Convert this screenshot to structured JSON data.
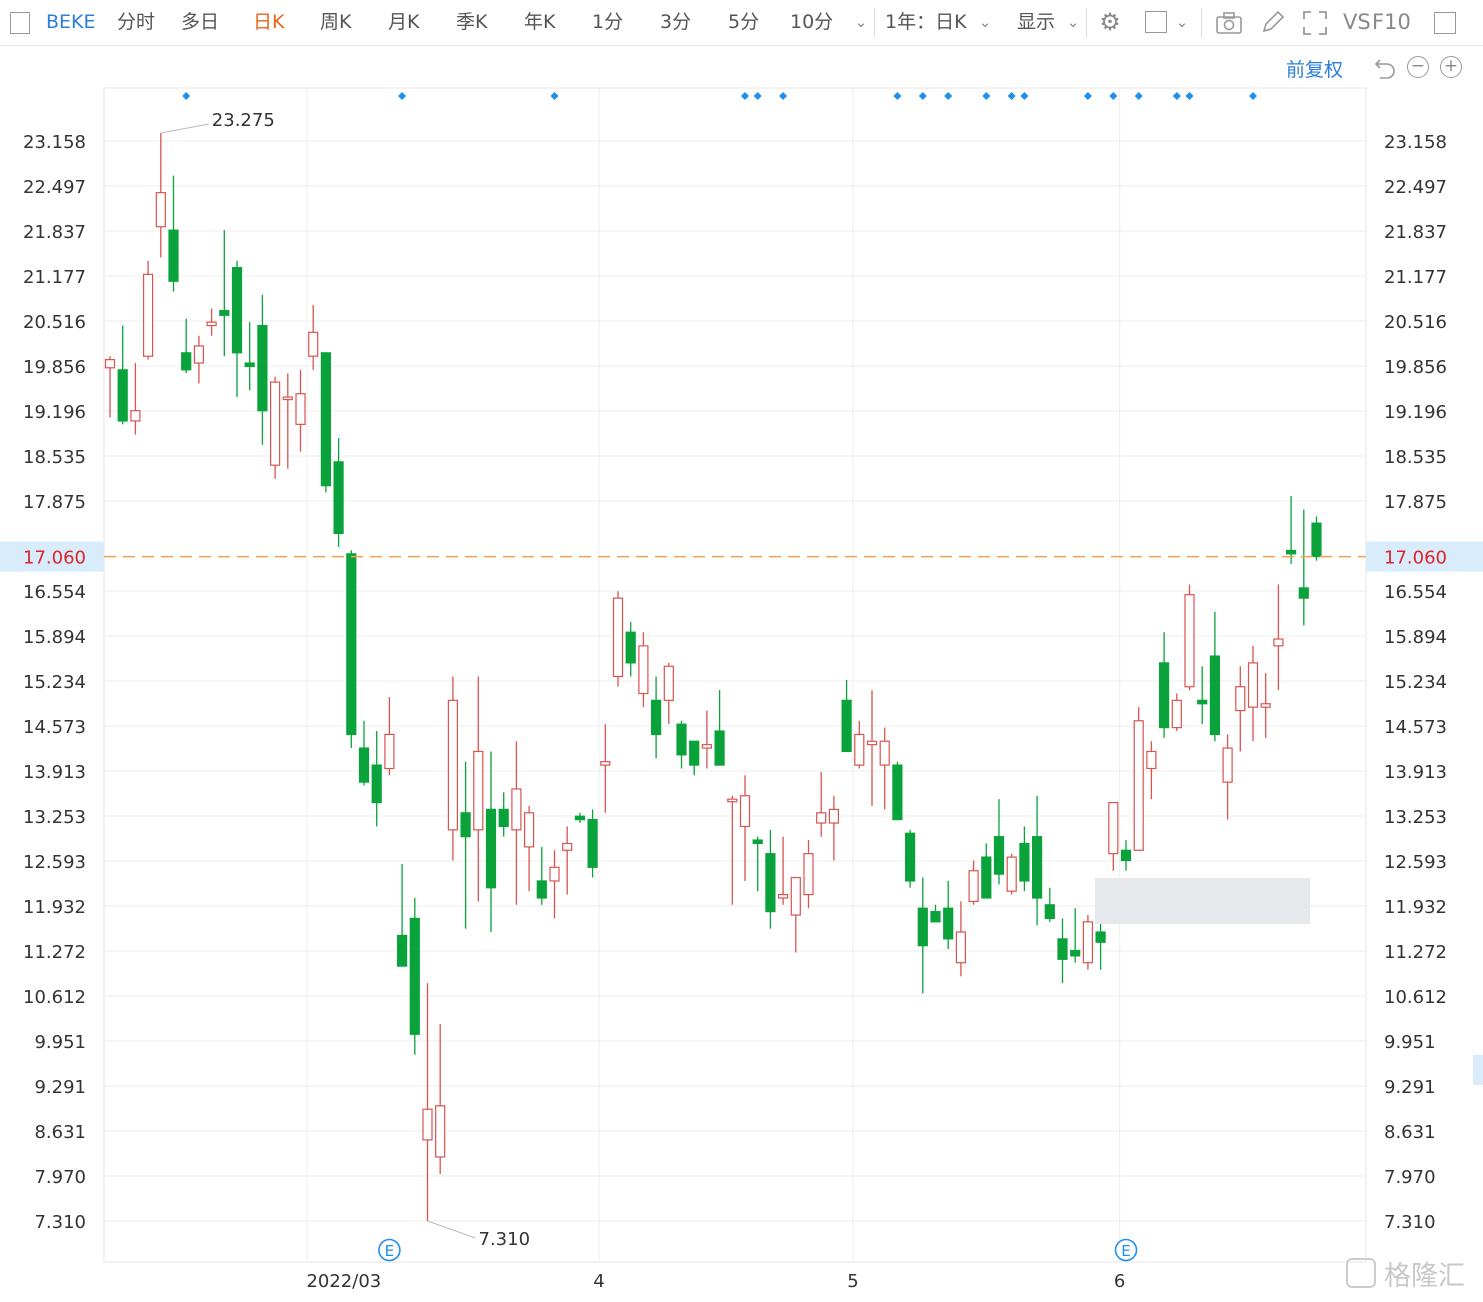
{
  "toolbar": {
    "symbol": "BEKE",
    "periods": [
      "分时",
      "多日",
      "日K",
      "周K",
      "月K",
      "季K",
      "年K",
      "1分",
      "3分",
      "5分",
      "10分"
    ],
    "active_period": "日K",
    "range_label": "1年：日K",
    "display_label": "显示",
    "vs_label": "VS",
    "f10_label": "F10",
    "adjust_label": "前复权",
    "icons": [
      "sidebar-toggle-icon",
      "chevron-down-icon",
      "gear-icon",
      "square-icon",
      "camera-icon",
      "pencil-icon",
      "fullscreen-icon",
      "panel-icon",
      "undo-icon",
      "zoom-out-icon",
      "zoom-in-icon"
    ]
  },
  "colors": {
    "up": "#d9534f",
    "down": "#0aa23b",
    "current_line": "#f0a050",
    "current_label": "#e0232b",
    "marker": "#1f8ef1",
    "grid": "#eeeeee"
  },
  "watermark": "格隆汇",
  "chart_data": {
    "type": "candlestick",
    "ylim": [
      7.31,
      23.158
    ],
    "yticks": [
      23.158,
      22.497,
      21.837,
      21.177,
      20.516,
      19.856,
      19.196,
      18.535,
      17.875,
      16.554,
      15.894,
      15.234,
      14.573,
      13.913,
      13.253,
      12.593,
      11.932,
      11.272,
      10.612,
      9.951,
      9.291,
      8.631,
      7.97,
      7.31
    ],
    "ytick_labels": [
      "23.158",
      "22.497",
      "21.837",
      "21.177",
      "20.516",
      "19.856",
      "19.196",
      "18.535",
      "17.875",
      "16.554",
      "15.894",
      "15.234",
      "14.573",
      "13.913",
      "13.253",
      "12.593",
      "11.932",
      "11.272",
      "10.612",
      "9.951",
      "9.291",
      "8.631",
      "7.970",
      "7.310"
    ],
    "xtick_labels": [
      {
        "label": "2022/03",
        "index": 16
      },
      {
        "label": "4",
        "index": 39
      },
      {
        "label": "5",
        "index": 59
      },
      {
        "label": "6",
        "index": 80
      }
    ],
    "current_price": 17.06,
    "current_price_label": "17.060",
    "max_label": {
      "value": 23.275,
      "text": "23.275",
      "index": 4
    },
    "min_label": {
      "value": 7.31,
      "text": "7.310",
      "index": 25
    },
    "event_markers": {
      "label": "E",
      "indices": [
        22,
        80
      ]
    },
    "dividend_marker_indices": [
      6,
      23,
      35,
      50,
      51,
      53,
      62,
      64,
      66,
      69,
      71,
      72,
      77,
      79,
      81,
      84,
      85,
      90
    ],
    "candles": [
      {
        "o": 19.83,
        "h": 20.0,
        "l": 19.1,
        "c": 19.95
      },
      {
        "o": 19.8,
        "h": 20.45,
        "l": 19.0,
        "c": 19.05
      },
      {
        "o": 19.05,
        "h": 19.9,
        "l": 18.85,
        "c": 19.2
      },
      {
        "o": 20.0,
        "h": 21.4,
        "l": 19.95,
        "c": 21.2
      },
      {
        "o": 21.9,
        "h": 23.275,
        "l": 21.45,
        "c": 22.4
      },
      {
        "o": 21.85,
        "h": 22.65,
        "l": 20.95,
        "c": 21.1
      },
      {
        "o": 20.05,
        "h": 20.55,
        "l": 19.75,
        "c": 19.8
      },
      {
        "o": 19.9,
        "h": 20.3,
        "l": 19.6,
        "c": 20.15
      },
      {
        "o": 20.45,
        "h": 20.7,
        "l": 20.3,
        "c": 20.5
      },
      {
        "o": 20.67,
        "h": 21.85,
        "l": 20.0,
        "c": 20.6
      },
      {
        "o": 21.3,
        "h": 21.4,
        "l": 19.4,
        "c": 20.05
      },
      {
        "o": 19.9,
        "h": 20.5,
        "l": 19.5,
        "c": 19.85
      },
      {
        "o": 20.45,
        "h": 20.9,
        "l": 18.7,
        "c": 19.2
      },
      {
        "o": 18.4,
        "h": 19.7,
        "l": 18.2,
        "c": 19.62
      },
      {
        "o": 19.4,
        "h": 19.75,
        "l": 18.35,
        "c": 19.4
      },
      {
        "o": 19.0,
        "h": 19.8,
        "l": 18.6,
        "c": 19.45
      },
      {
        "o": 20.0,
        "h": 20.75,
        "l": 19.8,
        "c": 20.35
      },
      {
        "o": 20.05,
        "h": 20.05,
        "l": 18.0,
        "c": 18.1
      },
      {
        "o": 18.45,
        "h": 18.8,
        "l": 17.2,
        "c": 17.4
      },
      {
        "o": 17.1,
        "h": 17.15,
        "l": 14.25,
        "c": 14.45
      },
      {
        "o": 14.25,
        "h": 14.65,
        "l": 13.7,
        "c": 13.75
      },
      {
        "o": 14.0,
        "h": 14.5,
        "l": 13.1,
        "c": 13.45
      },
      {
        "o": 13.95,
        "h": 15.0,
        "l": 13.85,
        "c": 14.45
      },
      {
        "o": 11.5,
        "h": 12.55,
        "l": 11.05,
        "c": 11.05
      },
      {
        "o": 11.75,
        "h": 12.05,
        "l": 9.75,
        "c": 10.05
      },
      {
        "o": 8.5,
        "h": 10.8,
        "l": 7.31,
        "c": 8.95
      },
      {
        "o": 8.25,
        "h": 10.2,
        "l": 8.0,
        "c": 9.0
      },
      {
        "o": 13.05,
        "h": 15.3,
        "l": 12.6,
        "c": 14.95
      },
      {
        "o": 13.3,
        "h": 14.05,
        "l": 11.6,
        "c": 12.95
      },
      {
        "o": 13.05,
        "h": 15.3,
        "l": 12.0,
        "c": 14.2
      },
      {
        "o": 13.35,
        "h": 14.2,
        "l": 11.55,
        "c": 12.2
      },
      {
        "o": 13.35,
        "h": 13.6,
        "l": 12.95,
        "c": 13.1
      },
      {
        "o": 13.05,
        "h": 14.35,
        "l": 11.95,
        "c": 13.65
      },
      {
        "o": 12.8,
        "h": 13.4,
        "l": 12.15,
        "c": 13.3
      },
      {
        "o": 12.3,
        "h": 12.8,
        "l": 11.95,
        "c": 12.05
      },
      {
        "o": 12.3,
        "h": 12.75,
        "l": 11.75,
        "c": 12.5
      },
      {
        "o": 12.75,
        "h": 13.1,
        "l": 12.1,
        "c": 12.85
      },
      {
        "o": 13.25,
        "h": 13.3,
        "l": 13.15,
        "c": 13.2
      },
      {
        "o": 13.2,
        "h": 13.35,
        "l": 12.35,
        "c": 12.5
      },
      {
        "o": 14.0,
        "h": 14.6,
        "l": 13.3,
        "c": 14.05
      },
      {
        "o": 15.3,
        "h": 16.55,
        "l": 15.15,
        "c": 16.45
      },
      {
        "o": 15.95,
        "h": 16.1,
        "l": 15.3,
        "c": 15.5
      },
      {
        "o": 15.05,
        "h": 15.95,
        "l": 14.85,
        "c": 15.75
      },
      {
        "o": 14.95,
        "h": 15.3,
        "l": 14.1,
        "c": 14.45
      },
      {
        "o": 14.95,
        "h": 15.5,
        "l": 14.6,
        "c": 15.45
      },
      {
        "o": 14.6,
        "h": 14.65,
        "l": 13.95,
        "c": 14.15
      },
      {
        "o": 14.35,
        "h": 14.35,
        "l": 13.85,
        "c": 14.0
      },
      {
        "o": 14.25,
        "h": 14.8,
        "l": 13.95,
        "c": 14.3
      },
      {
        "o": 14.5,
        "h": 15.1,
        "l": 14.05,
        "c": 14.0
      },
      {
        "o": 13.5,
        "h": 13.55,
        "l": 11.95,
        "c": 13.5
      },
      {
        "o": 13.1,
        "h": 13.85,
        "l": 12.3,
        "c": 13.55
      },
      {
        "o": 12.9,
        "h": 12.95,
        "l": 12.15,
        "c": 12.85
      },
      {
        "o": 12.7,
        "h": 13.05,
        "l": 11.6,
        "c": 11.85
      },
      {
        "o": 12.05,
        "h": 12.95,
        "l": 11.95,
        "c": 12.1
      },
      {
        "o": 11.8,
        "h": 12.35,
        "l": 11.25,
        "c": 12.35
      },
      {
        "o": 12.1,
        "h": 12.9,
        "l": 11.9,
        "c": 12.7
      },
      {
        "o": 13.15,
        "h": 13.9,
        "l": 12.95,
        "c": 13.3
      },
      {
        "o": 13.15,
        "h": 13.55,
        "l": 12.6,
        "c": 13.35
      },
      {
        "o": 14.95,
        "h": 15.25,
        "l": 14.2,
        "c": 14.2
      },
      {
        "o": 14.0,
        "h": 14.65,
        "l": 13.95,
        "c": 14.45
      },
      {
        "o": 14.3,
        "h": 15.1,
        "l": 13.4,
        "c": 14.35
      },
      {
        "o": 14.0,
        "h": 14.55,
        "l": 13.35,
        "c": 14.35
      },
      {
        "o": 14.0,
        "h": 14.05,
        "l": 13.2,
        "c": 13.2
      },
      {
        "o": 13.0,
        "h": 13.05,
        "l": 12.2,
        "c": 12.3
      },
      {
        "o": 11.9,
        "h": 12.35,
        "l": 10.65,
        "c": 11.35
      },
      {
        "o": 11.85,
        "h": 11.95,
        "l": 11.7,
        "c": 11.7
      },
      {
        "o": 11.9,
        "h": 12.3,
        "l": 11.3,
        "c": 11.45
      },
      {
        "o": 11.1,
        "h": 12.0,
        "l": 10.9,
        "c": 11.55
      },
      {
        "o": 12.0,
        "h": 12.6,
        "l": 11.95,
        "c": 12.45
      },
      {
        "o": 12.65,
        "h": 12.85,
        "l": 12.05,
        "c": 12.05
      },
      {
        "o": 12.95,
        "h": 13.5,
        "l": 12.25,
        "c": 12.4
      },
      {
        "o": 12.15,
        "h": 12.7,
        "l": 12.1,
        "c": 12.65
      },
      {
        "o": 12.85,
        "h": 13.1,
        "l": 12.15,
        "c": 12.3
      },
      {
        "o": 12.95,
        "h": 13.55,
        "l": 11.65,
        "c": 12.05
      },
      {
        "o": 11.95,
        "h": 12.2,
        "l": 11.7,
        "c": 11.75
      },
      {
        "o": 11.45,
        "h": 11.75,
        "l": 10.8,
        "c": 11.15
      },
      {
        "o": 11.28,
        "h": 11.9,
        "l": 11.1,
        "c": 11.2
      },
      {
        "o": 11.1,
        "h": 11.8,
        "l": 11.0,
        "c": 11.7
      },
      {
        "o": 11.55,
        "h": 12.0,
        "l": 11.0,
        "c": 11.4
      },
      {
        "o": 12.7,
        "h": 13.45,
        "l": 12.45,
        "c": 13.45
      },
      {
        "o": 12.75,
        "h": 12.9,
        "l": 12.45,
        "c": 12.6
      },
      {
        "o": 12.75,
        "h": 14.85,
        "l": 12.75,
        "c": 14.65
      },
      {
        "o": 13.95,
        "h": 14.35,
        "l": 13.5,
        "c": 14.2
      },
      {
        "o": 15.5,
        "h": 15.95,
        "l": 14.4,
        "c": 14.55
      },
      {
        "o": 14.55,
        "h": 15.05,
        "l": 14.5,
        "c": 14.95
      },
      {
        "o": 15.15,
        "h": 16.65,
        "l": 15.1,
        "c": 16.5
      },
      {
        "o": 14.95,
        "h": 15.45,
        "l": 14.6,
        "c": 14.9
      },
      {
        "o": 15.6,
        "h": 16.25,
        "l": 14.35,
        "c": 14.45
      },
      {
        "o": 13.75,
        "h": 14.45,
        "l": 13.2,
        "c": 14.25
      },
      {
        "o": 14.8,
        "h": 15.45,
        "l": 14.2,
        "c": 15.15
      },
      {
        "o": 14.85,
        "h": 15.75,
        "l": 14.35,
        "c": 15.5
      },
      {
        "o": 14.85,
        "h": 15.35,
        "l": 14.4,
        "c": 14.9
      },
      {
        "o": 15.75,
        "h": 16.65,
        "l": 15.1,
        "c": 15.85
      },
      {
        "o": 17.15,
        "h": 17.95,
        "l": 16.95,
        "c": 17.1
      },
      {
        "o": 16.6,
        "h": 17.75,
        "l": 16.05,
        "c": 16.45
      },
      {
        "o": 17.55,
        "h": 17.65,
        "l": 17.0,
        "c": 17.06
      }
    ]
  }
}
